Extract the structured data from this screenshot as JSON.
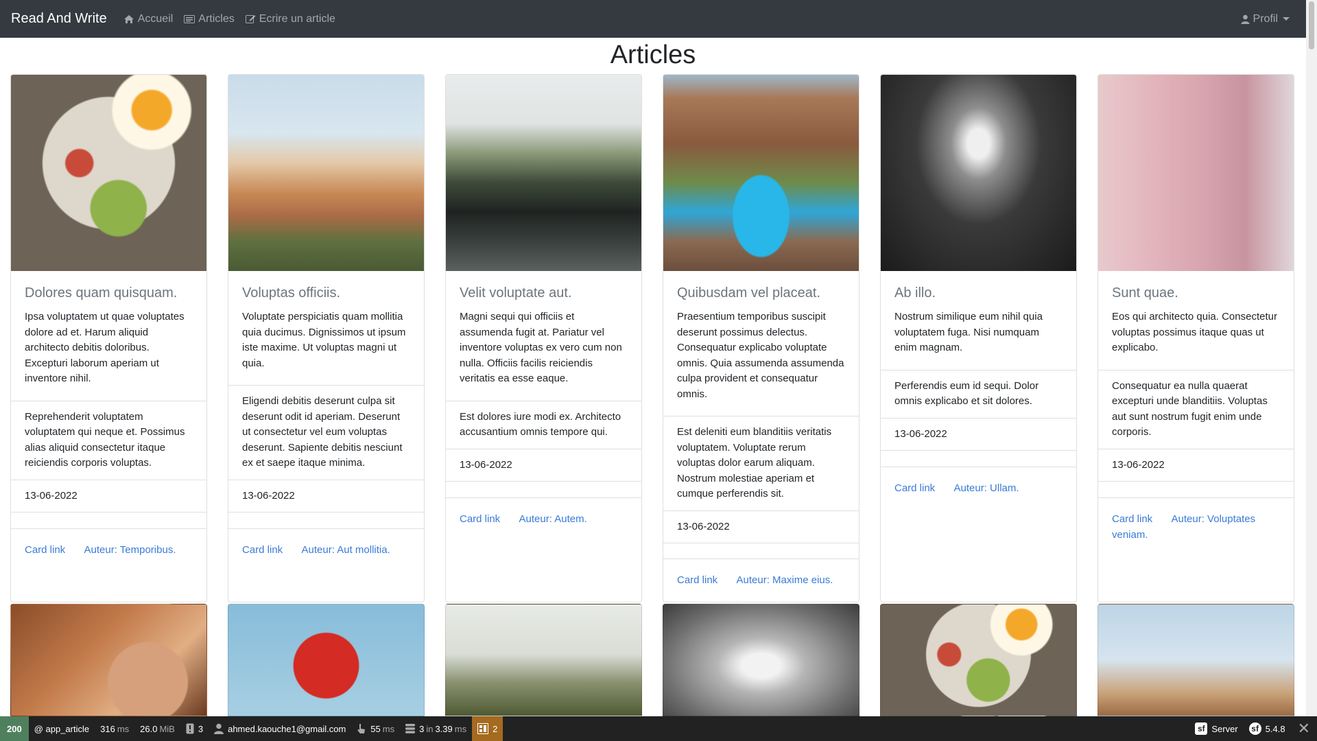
{
  "navbar": {
    "brand": "Read And Write",
    "links": [
      {
        "label": "Accueil",
        "icon": "home-icon"
      },
      {
        "label": "Articles",
        "icon": "newspaper-icon"
      },
      {
        "label": "Ecrire un article",
        "icon": "edit-icon"
      }
    ],
    "profile_label": "Profil"
  },
  "page": {
    "title": "Articles"
  },
  "cards": [
    {
      "image": "breakfast-plate-photo",
      "title": "Dolores quam quisquam.",
      "text": "Ipsa voluptatem ut quae voluptates dolore ad et. Harum aliquid architecto debitis doloribus. Excepturi laborum aperiam ut inventore nihil.",
      "extra": "Reprehenderit voluptatem voluptatem qui neque et. Possimus alias aliquid consectetur itaque reiciendis corporis voluptas.",
      "date": "13-06-2022",
      "link_label": "Card link",
      "author_label": "Auteur: Temporibus."
    },
    {
      "image": "colorful-city-photo",
      "title": "Voluptas officiis.",
      "text": "Voluptate perspiciatis quam mollitia quia ducimus. Dignissimos ut ipsum iste maxime. Ut voluptas magni ut quia.",
      "extra": "Eligendi debitis deserunt culpa sit deserunt odit id aperiam. Deserunt ut consectetur vel eum voluptas deserunt. Sapiente debitis nesciunt ex et saepe itaque minima.",
      "date": "13-06-2022",
      "link_label": "Card link",
      "author_label": "Auteur: Aut mollitia."
    },
    {
      "image": "airport-lounge-photo",
      "title": "Velit voluptate aut.",
      "text": "Magni sequi qui officiis et assumenda fugit at. Pariatur vel inventore voluptas ex vero cum non nulla. Officiis facilis reiciendis veritatis ea esse eaque.",
      "extra": "Est dolores iure modi ex. Architecto accusantium omnis tempore qui.",
      "date": "13-06-2022",
      "link_label": "Card link",
      "author_label": "Auteur: Autem."
    },
    {
      "image": "canyon-waterfall-photo",
      "title": "Quibusdam vel placeat.",
      "text": "Praesentium temporibus suscipit deserunt possimus delectus. Consequatur explicabo voluptate omnis. Quia assumenda assumenda culpa provident et consequatur omnis.",
      "extra": "Est deleniti eum blanditiis veritatis voluptatem. Voluptate rerum voluptas dolor earum aliquam. Nostrum molestiae aperiam et cumque perferendis sit.",
      "date": "13-06-2022",
      "link_label": "Card link",
      "author_label": "Auteur: Maxime eius."
    },
    {
      "image": "escalator-tunnel-photo",
      "title": "Ab illo.",
      "text": "Nostrum similique eum nihil quia voluptatem fuga. Nisi numquam enim magnam.",
      "extra": "Perferendis eum id sequi. Dolor omnis explicabo et sit dolores.",
      "date": "13-06-2022",
      "link_label": "Card link",
      "author_label": "Auteur: Ullam."
    },
    {
      "image": "pink-building-photo",
      "title": "Sunt quae.",
      "text": "Eos qui architecto quia. Consectetur voluptas possimus itaque quas ut explicabo.",
      "extra": "Consequatur ea nulla quaerat excepturi unde blanditiis. Voluptas aut sunt nostrum fugit enim unde corporis.",
      "date": "13-06-2022",
      "link_label": "Card link",
      "author_label": "Auteur: Voluptates veniam."
    }
  ],
  "cards_row2": [
    {
      "image": "mother-baby-photo"
    },
    {
      "image": "red-drink-photo"
    },
    {
      "image": "foggy-field-photo"
    },
    {
      "image": "bright-tunnel-photo"
    },
    {
      "image": "breakfast-plate-photo"
    },
    {
      "image": "city-rooftops-photo"
    }
  ],
  "debug_toolbar": {
    "status_code": "200",
    "route": "@ app_article",
    "time_value": "316",
    "time_unit": "ms",
    "memory_value": "26.0",
    "memory_unit": "MiB",
    "logs_count": "3",
    "user": "ahmed.kaouche1@gmail.com",
    "request_time_value": "55",
    "request_time_unit": "ms",
    "db_queries": "3",
    "db_in": "in",
    "db_time": "3.39",
    "db_unit": "ms",
    "twig_count": "2",
    "server_label": "Server",
    "version": "5.4.8",
    "status_color": "#4f805d",
    "warn_color": "#a46a1f"
  }
}
